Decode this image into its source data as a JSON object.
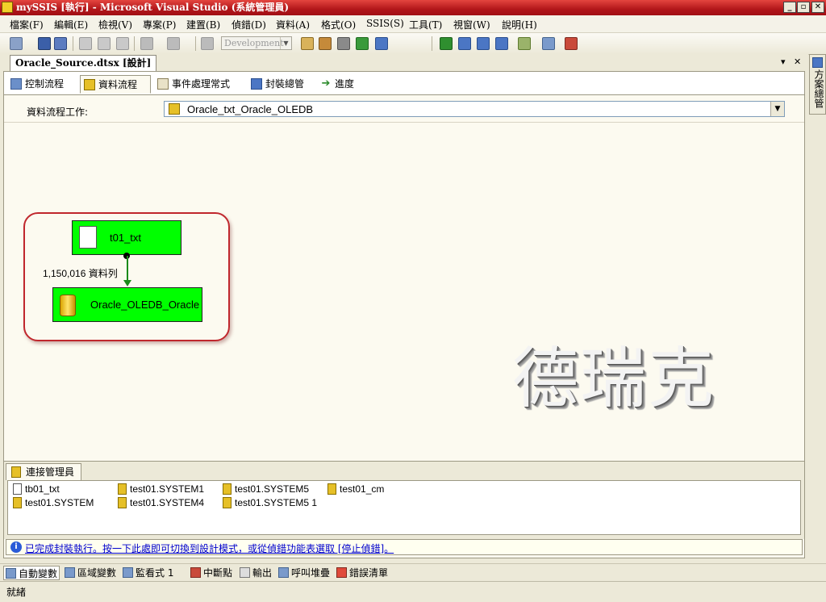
{
  "window": {
    "title": "mySSIS [執行] - Microsoft Visual Studio (系統管理員)",
    "min_label": "_",
    "max_label": "▫",
    "close_label": "✕"
  },
  "menu": [
    "檔案(F)",
    "編輯(E)",
    "檢視(V)",
    "專案(P)",
    "建置(B)",
    "偵錯(D)",
    "資料(A)",
    "格式(O)",
    "SSIS(S)",
    "工具(T)",
    "視窗(W)",
    "說明(H)"
  ],
  "toolbar": {
    "configuration": "Development"
  },
  "document": {
    "tab_label": "Oracle_Source.dtsx [設計]",
    "dropdown_glyph": "▾",
    "close_glyph": "✕"
  },
  "designer_tabs": [
    {
      "label": "控制流程",
      "icon": "control-flow-icon",
      "active": false
    },
    {
      "label": "資料流程",
      "icon": "data-flow-icon",
      "active": true
    },
    {
      "label": "事件處理常式",
      "icon": "event-handler-icon",
      "active": false
    },
    {
      "label": "封裝總管",
      "icon": "package-explorer-icon",
      "active": false
    },
    {
      "label": "進度",
      "icon": "progress-icon",
      "active": false
    }
  ],
  "data_flow_task": {
    "label": "資料流程工作:",
    "value": "Oracle_txt_Oracle_OLEDB"
  },
  "components": {
    "source": "t01_txt",
    "destination": "Oracle_OLEDB_Oracle",
    "row_count": "1,150,016 資料列"
  },
  "watermark": "德瑞克",
  "connection_managers": {
    "tab_label": "連接管理員",
    "items": [
      {
        "name": "tb01_txt",
        "icon": "flat-file-icon"
      },
      {
        "name": "test01.SYSTEM",
        "icon": "db-connection-icon"
      },
      {
        "name": "test01.SYSTEM1",
        "icon": "db-connection-icon"
      },
      {
        "name": "test01.SYSTEM4",
        "icon": "db-connection-icon"
      },
      {
        "name": "test01.SYSTEM5",
        "icon": "db-connection-icon"
      },
      {
        "name": "test01.SYSTEM5 1",
        "icon": "db-connection-icon"
      },
      {
        "name": "test01_cm",
        "icon": "db-connection-icon"
      }
    ]
  },
  "info_bar": {
    "message": "已完成封裝執行。按一下此處即可切換到設計模式，或從偵錯功能表選取 [停止偵錯]。"
  },
  "side_panel": {
    "label": "方案總管"
  },
  "tool_tabs": [
    {
      "label": "自動變數",
      "icon": "autos-icon"
    },
    {
      "label": "區域變數",
      "icon": "locals-icon"
    },
    {
      "label": "監看式 1",
      "icon": "watch-icon"
    },
    {
      "label": "中斷點",
      "icon": "breakpoints-icon"
    },
    {
      "label": "輸出",
      "icon": "output-icon"
    },
    {
      "label": "呼叫堆疊",
      "icon": "call-stack-icon"
    },
    {
      "label": "錯誤清單",
      "icon": "error-list-icon"
    }
  ],
  "status": {
    "text": "就緒"
  },
  "colors": {
    "component_fill": "#00ff00",
    "highlight_frame": "#c0272d",
    "title_bar": "#b2161a",
    "data_path": "#1a8a1a"
  }
}
